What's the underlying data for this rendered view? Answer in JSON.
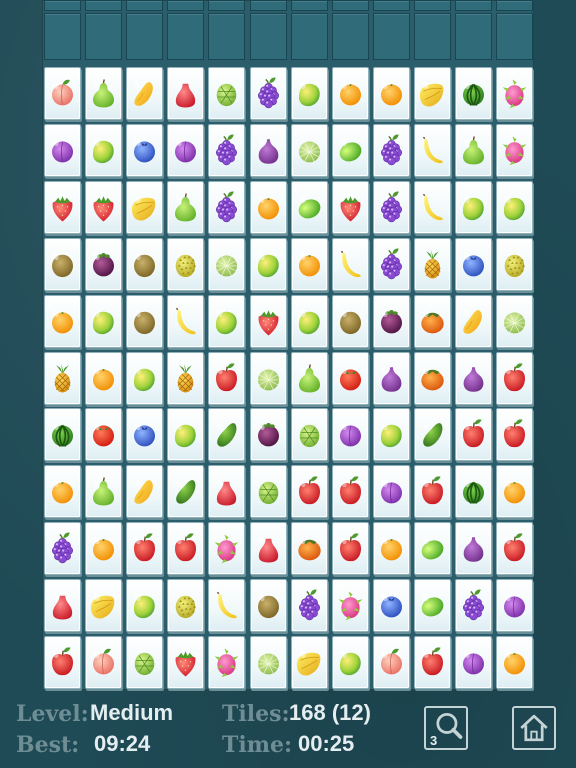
{
  "board": {
    "rows": [
      [
        "peach",
        "pear",
        "papaya",
        "wax-apple",
        "cherimoya",
        "grapes",
        "mango",
        "orange",
        "orange",
        "starfruit",
        "watermelon",
        "dragonfruit"
      ],
      [
        "plum",
        "mango",
        "blueberry",
        "plum",
        "grapes",
        "fig",
        "melon",
        "lime",
        "grapes",
        "banana",
        "pear",
        "dragonfruit"
      ],
      [
        "strawberry",
        "strawberry",
        "starfruit",
        "pear",
        "grapes",
        "orange",
        "lime",
        "strawberry",
        "grapes",
        "banana",
        "mango",
        "mango"
      ],
      [
        "kiwi",
        "mangosteen",
        "kiwi",
        "durian",
        "melon",
        "mango",
        "orange",
        "banana",
        "grapes",
        "pineapple",
        "blueberry",
        "durian"
      ],
      [
        "orange",
        "mango",
        "kiwi",
        "banana",
        "mango",
        "strawberry",
        "mango",
        "kiwi",
        "mangosteen",
        "persimmon",
        "papaya",
        "melon"
      ],
      [
        "pineapple",
        "orange",
        "mango",
        "pineapple",
        "apple",
        "melon",
        "pear",
        "tomato",
        "fig",
        "persimmon",
        "fig",
        "apple"
      ],
      [
        "watermelon",
        "tomato",
        "blueberry",
        "mango",
        "avocado",
        "mangosteen",
        "cherimoya",
        "plum",
        "mango",
        "avocado",
        "apple",
        "apple"
      ],
      [
        "orange",
        "pear",
        "papaya",
        "avocado",
        "wax-apple",
        "cherimoya",
        "apple",
        "apple",
        "plum",
        "apple",
        "watermelon",
        "orange"
      ],
      [
        "grapes",
        "orange",
        "apple",
        "apple",
        "dragonfruit",
        "wax-apple",
        "persimmon",
        "apple",
        "orange",
        "lime",
        "fig",
        "apple"
      ],
      [
        "wax-apple",
        "starfruit",
        "mango",
        "durian",
        "banana",
        "kiwi",
        "grapes",
        "dragonfruit",
        "blueberry",
        "lime",
        "grapes",
        "plum"
      ],
      [
        "apple",
        "peach",
        "cherimoya",
        "strawberry",
        "dragonfruit",
        "melon",
        "starfruit",
        "mango",
        "peach",
        "apple",
        "plum",
        "orange"
      ]
    ]
  },
  "hud": {
    "level_label": "Level:",
    "level_value": "Medium",
    "tiles_label": "Tiles:",
    "tiles_value": "168 (12)",
    "best_label": "Best:",
    "best_value": "09:24",
    "time_label": "Time:",
    "time_value": "00:25",
    "hint_count": "3",
    "hint_icon": "magnifier-icon",
    "home_icon": "home-icon"
  }
}
